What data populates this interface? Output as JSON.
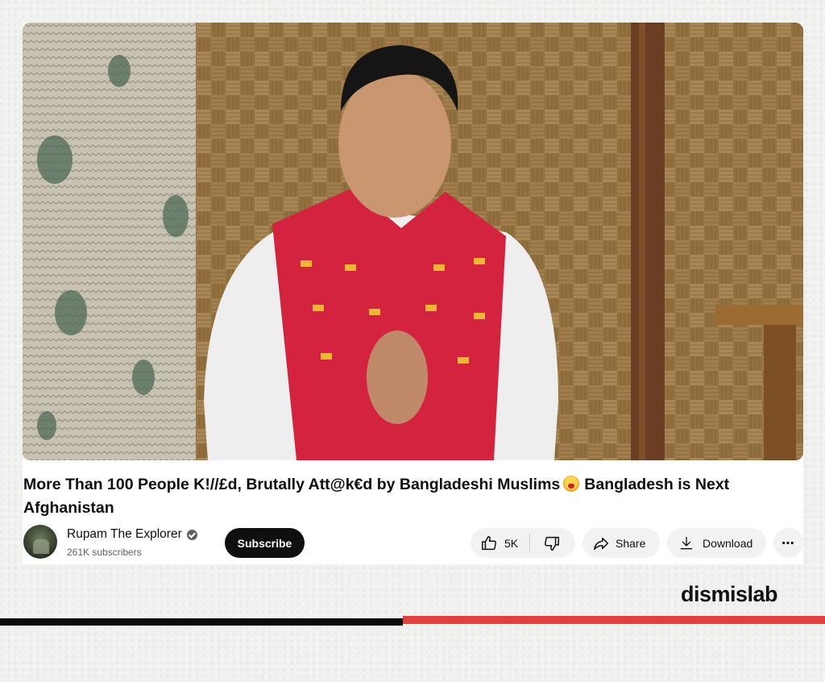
{
  "video": {
    "title": "More Than 100 People K!//£d, Brutally Att@k€d by Bangladeshi Muslims",
    "title_tail": "Bangladesh is Next Afghanistan",
    "emoji": "crying-face-emoji"
  },
  "channel": {
    "name": "Rupam The Explorer",
    "subscribers": "261K subscribers",
    "verified_icon": "verified-badge-icon"
  },
  "actions": {
    "subscribe_label": "Subscribe",
    "like_count": "5K",
    "share_label": "Share",
    "download_label": "Download",
    "more_label": "⋯"
  },
  "brand": {
    "logo_text": "dismislab"
  },
  "colors": {
    "subscribe_bg": "#0f0f0f",
    "pill_bg": "#f2f2f2",
    "accent_red": "#e2403f",
    "accent_black": "#0b0b0b"
  }
}
